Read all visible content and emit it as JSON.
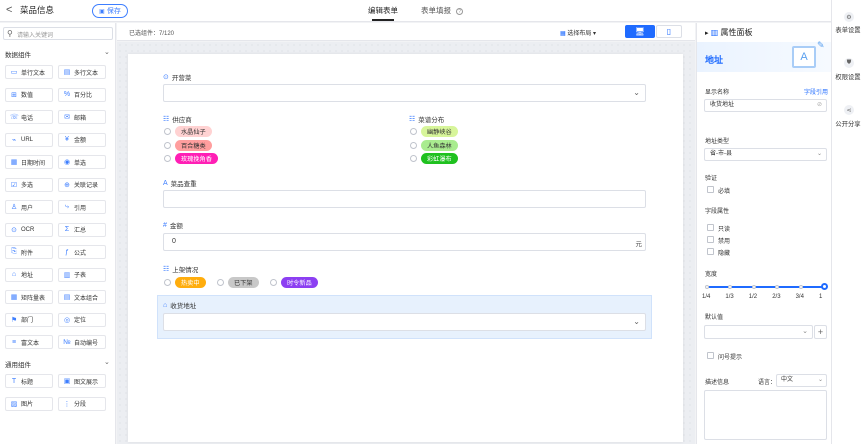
{
  "header": {
    "back": "<",
    "title": "菜品信息",
    "save_label": "保存",
    "tabs": [
      "编辑表单",
      "表单填报"
    ]
  },
  "left": {
    "search_placeholder": "请输入关键词",
    "section1": "数据组件",
    "data_components": [
      "单行文本",
      "多行文本",
      "数值",
      "百分比",
      "电话",
      "邮箱",
      "URL",
      "金额",
      "日期时间",
      "单选",
      "多选",
      "关联记录",
      "用户",
      "引用",
      "OCR",
      "汇总",
      "附件",
      "公式",
      "地址",
      "子表",
      "矩阵量表",
      "文本组合",
      "部门",
      "定位",
      "富文本",
      "自动编号"
    ],
    "section2": "通用组件",
    "common_components": [
      "标题",
      "图文展示",
      "图片",
      "分段"
    ]
  },
  "toolbar": {
    "selected": "已选组件：7/120",
    "layout": "选择布局"
  },
  "form": {
    "f1": {
      "label": "开营菜"
    },
    "f2": {
      "label": "供应商",
      "options": [
        {
          "text": "水晶仙子",
          "bg": "#ffd2d2",
          "color": "#333"
        },
        {
          "text": "百合糖类",
          "bg": "#ff9e9e",
          "color": "#333"
        },
        {
          "text": "玫瑰挽角香",
          "bg": "#ff1fb5",
          "color": "#fff"
        }
      ]
    },
    "f3": {
      "label": "菜谱分布",
      "options": [
        {
          "text": "幽静峡谷",
          "bg": "#d7f59a",
          "color": "#333"
        },
        {
          "text": "人鱼森林",
          "bg": "#a9ec8f",
          "color": "#333"
        },
        {
          "text": "彩虹瀑布",
          "bg": "#1fc11f",
          "color": "#fff"
        }
      ]
    },
    "f4": {
      "label": "菜品查重"
    },
    "f5": {
      "label": "金额",
      "value": "0",
      "unit": "元"
    },
    "f6": {
      "label": "上架情况",
      "options": [
        {
          "text": "热卖中",
          "bg": "#ffad0d",
          "color": "#fff"
        },
        {
          "text": "已下架",
          "bg": "#c8c8c8",
          "color": "#333"
        },
        {
          "text": "时令新品",
          "bg": "#8c3ff2",
          "color": "#fff"
        }
      ]
    },
    "f7": {
      "label": "收货地址"
    }
  },
  "panel": {
    "title": "属性面板",
    "field_title": "地址",
    "display_name_label": "显示名称",
    "field_ref": "字段引用",
    "display_name_value": "收货地址",
    "addr_type_label": "地址类型",
    "addr_type_value": "省-市-县",
    "validation_label": "验证",
    "required": "必填",
    "field_attr_label": "字段属性",
    "readonly": "只读",
    "disabled": "禁用",
    "hidden": "隐藏",
    "width_label": "宽度",
    "width_ticks": [
      "1/4",
      "1/3",
      "1/2",
      "2/3",
      "3/4",
      "1"
    ],
    "width_value": 1,
    "default_label": "默认值",
    "hint_label": "问号提示",
    "desc_label": "描述信息",
    "lang_label": "语言：",
    "lang_value": "中文"
  },
  "far": {
    "items": [
      "表单设置",
      "权限设置",
      "公开分享"
    ]
  },
  "colors": {
    "accent": "#1f6bff"
  }
}
